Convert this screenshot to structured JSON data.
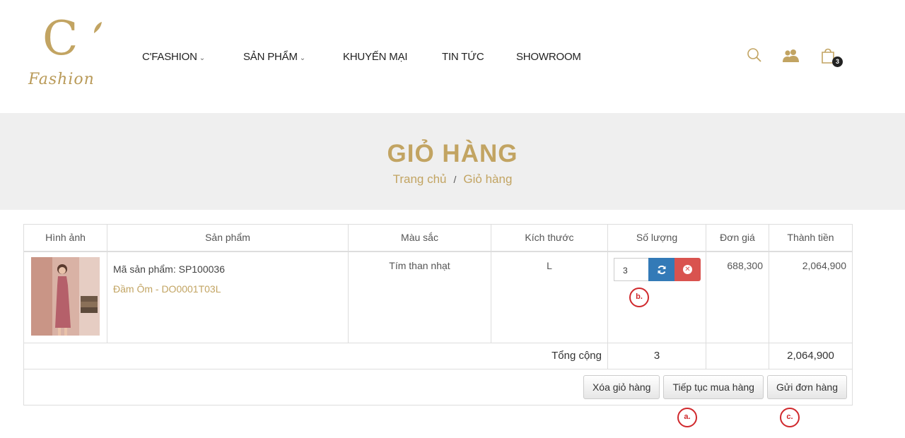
{
  "brand": {
    "logo_script": "Fashion",
    "logo_letter": "C"
  },
  "nav": {
    "items": [
      {
        "label": "C'FASHION",
        "has_dropdown": true
      },
      {
        "label": "SẢN PHẨM",
        "has_dropdown": true
      },
      {
        "label": "KHUYẾN MẠI",
        "has_dropdown": false
      },
      {
        "label": "TIN TỨC",
        "has_dropdown": false
      },
      {
        "label": "SHOWROOM",
        "has_dropdown": false
      }
    ],
    "dropdown_chevron": "⌄"
  },
  "header_icons": {
    "search": "search-icon",
    "account": "users-icon",
    "cart": "shopping-bag-icon",
    "cart_count": "3"
  },
  "banner": {
    "title": "GIỎ HÀNG",
    "breadcrumb": {
      "home": "Trang chủ",
      "separator": "/",
      "current": "Giỏ hàng"
    }
  },
  "table": {
    "headers": [
      "Hình ảnh",
      "Sản phẩm",
      "Màu sắc",
      "Kích thước",
      "Số lượng",
      "Đơn giá",
      "Thành tiền"
    ],
    "rows": [
      {
        "product_code": "Mã sản phẩm: SP100036",
        "product_name": "Đầm Ôm - DO0001T03L",
        "color": "Tím than nhạt",
        "size": "L",
        "quantity": "3",
        "unit_price": "688,300",
        "line_total": "2,064,900"
      }
    ],
    "total_label": "Tổng cộng",
    "total_quantity": "3",
    "total_amount": "2,064,900"
  },
  "actions": {
    "clear": "Xóa giỏ hàng",
    "continue": "Tiếp tục mua hàng",
    "submit": "Gửi đơn hàng"
  },
  "annotations": {
    "a": "a.",
    "b": "b.",
    "c": "c."
  },
  "colors": {
    "accent_gold": "#c2a462",
    "refresh_blue": "#337ab7",
    "delete_red": "#d9534f",
    "annotation_red": "#d0282c",
    "banner_bg": "#efefef"
  }
}
